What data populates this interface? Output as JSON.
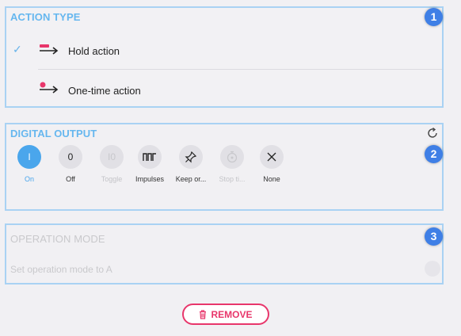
{
  "action_type": {
    "title": "ACTION TYPE",
    "marker": "1",
    "options": [
      {
        "label": "Hold action",
        "selected": true,
        "icon": "hold-action-icon"
      },
      {
        "label": "One-time action",
        "selected": false,
        "icon": "one-time-action-icon"
      }
    ]
  },
  "digital_output": {
    "title": "DIGITAL OUTPUT",
    "marker": "2",
    "reset_icon": "reset-icon",
    "options": [
      {
        "symbol": "I",
        "label": "On",
        "state": "selected"
      },
      {
        "symbol": "0",
        "label": "Off",
        "state": "normal"
      },
      {
        "symbol": "I0",
        "label": "Toggle",
        "state": "disabled"
      },
      {
        "symbol": "ᴨᴨ",
        "label": "Impulses",
        "state": "normal"
      },
      {
        "symbol": "pin",
        "label": "Keep or...",
        "state": "normal"
      },
      {
        "symbol": "timer",
        "label": "Stop ti...",
        "state": "disabled"
      },
      {
        "symbol": "×",
        "label": "None",
        "state": "normal"
      }
    ]
  },
  "operation_mode": {
    "title": "OPERATION MODE",
    "marker": "3",
    "label": "Set operation mode to A"
  },
  "remove_button": {
    "label": "REMOVE"
  },
  "colors": {
    "accent": "#4aa6ec",
    "marker": "#3f7fe6",
    "remove": "#e8366b",
    "frame": "#a9d2f3"
  }
}
